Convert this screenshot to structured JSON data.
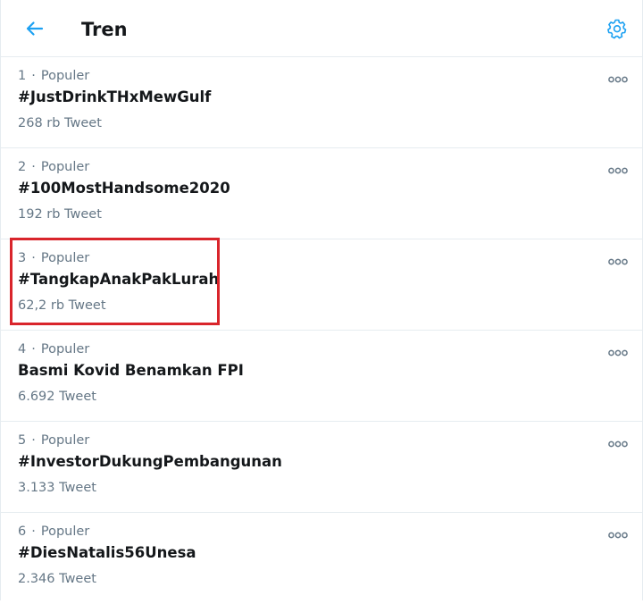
{
  "header": {
    "title": "Tren"
  },
  "trends": [
    {
      "rank": "1",
      "category": "Populer",
      "name": "#JustDrinkTHxMewGulf",
      "count": "268 rb Tweet"
    },
    {
      "rank": "2",
      "category": "Populer",
      "name": "#100MostHandsome2020",
      "count": "192 rb Tweet"
    },
    {
      "rank": "3",
      "category": "Populer",
      "name": "#TangkapAnakPakLurah",
      "count": "62,2 rb Tweet"
    },
    {
      "rank": "4",
      "category": "Populer",
      "name": "Basmi Kovid Benamkan FPI",
      "count": "6.692 Tweet"
    },
    {
      "rank": "5",
      "category": "Populer",
      "name": "#InvestorDukungPembangunan",
      "count": "3.133 Tweet"
    },
    {
      "rank": "6",
      "category": "Populer",
      "name": "#DiesNatalis56Unesa",
      "count": "2.346 Tweet"
    }
  ],
  "separator": "·",
  "icons": {
    "back": "arrow-left-icon",
    "settings": "gear-icon",
    "more": "more-dots-icon"
  },
  "colors": {
    "accent": "#1da1f2",
    "text": "#14171a",
    "secondary": "#657786",
    "divider": "#e6ecf0",
    "highlight": "#d9252b"
  }
}
